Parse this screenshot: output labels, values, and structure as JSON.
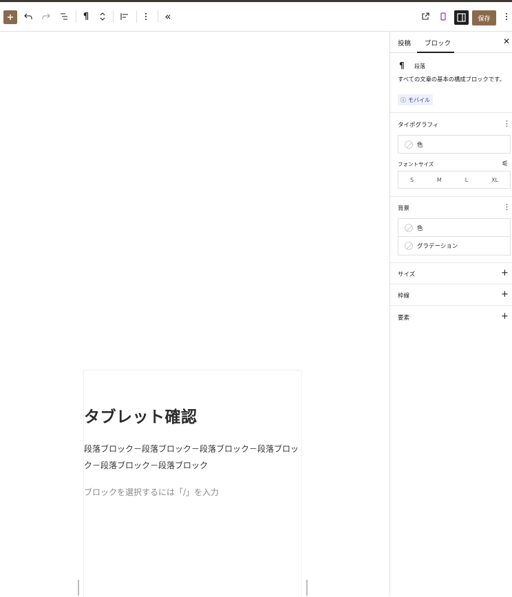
{
  "toolbar": {
    "inserter_icon": "plus-icon",
    "undo_icon": "undo-icon",
    "redo_icon": "redo-icon",
    "list_view_icon": "list-view-icon",
    "paragraph_icon": "¶",
    "save_label": "保存"
  },
  "sidebar": {
    "tabs": [
      {
        "label": "投稿"
      },
      {
        "label": "ブロック"
      }
    ],
    "block": {
      "icon": "¶",
      "name": "段落",
      "description": "すべての文章の基本の構成ブロックです。",
      "badge": "モバイル"
    },
    "typography": {
      "title": "タイポグラフィ",
      "color_label": "色",
      "font_size_label": "フォントサイズ",
      "sizes": [
        "S",
        "M",
        "L",
        "XL"
      ]
    },
    "background": {
      "title": "背景",
      "color_label": "色",
      "gradient_label": "グラデーション"
    },
    "panels": [
      {
        "label": "サイズ"
      },
      {
        "label": "枠線"
      },
      {
        "label": "要素"
      }
    ]
  },
  "canvas": {
    "heading": "タブレット確認",
    "paragraph": "段落ブロック－段落ブロック－段落ブロック－段落ブロック－段落ブロック－段落ブロック",
    "placeholder": "ブロックを選択するには「/」を入力"
  },
  "colors": {
    "accent": "#8a6a4d",
    "dark": "#1e1e1e",
    "badge_bg": "#eef0fb",
    "badge_text": "#2b3f9e"
  }
}
